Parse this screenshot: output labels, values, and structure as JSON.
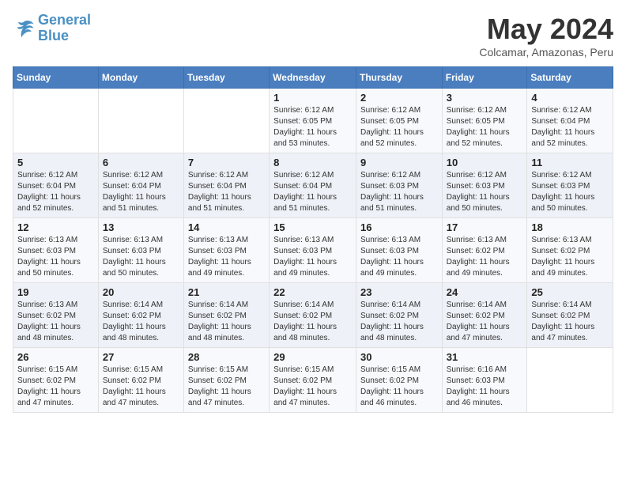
{
  "logo": {
    "line1": "General",
    "line2": "Blue"
  },
  "title": "May 2024",
  "subtitle": "Colcamar, Amazonas, Peru",
  "weekdays": [
    "Sunday",
    "Monday",
    "Tuesday",
    "Wednesday",
    "Thursday",
    "Friday",
    "Saturday"
  ],
  "weeks": [
    [
      {
        "day": "",
        "info": ""
      },
      {
        "day": "",
        "info": ""
      },
      {
        "day": "",
        "info": ""
      },
      {
        "day": "1",
        "info": "Sunrise: 6:12 AM\nSunset: 6:05 PM\nDaylight: 11 hours and 53 minutes."
      },
      {
        "day": "2",
        "info": "Sunrise: 6:12 AM\nSunset: 6:05 PM\nDaylight: 11 hours and 52 minutes."
      },
      {
        "day": "3",
        "info": "Sunrise: 6:12 AM\nSunset: 6:05 PM\nDaylight: 11 hours and 52 minutes."
      },
      {
        "day": "4",
        "info": "Sunrise: 6:12 AM\nSunset: 6:04 PM\nDaylight: 11 hours and 52 minutes."
      }
    ],
    [
      {
        "day": "5",
        "info": "Sunrise: 6:12 AM\nSunset: 6:04 PM\nDaylight: 11 hours and 52 minutes."
      },
      {
        "day": "6",
        "info": "Sunrise: 6:12 AM\nSunset: 6:04 PM\nDaylight: 11 hours and 51 minutes."
      },
      {
        "day": "7",
        "info": "Sunrise: 6:12 AM\nSunset: 6:04 PM\nDaylight: 11 hours and 51 minutes."
      },
      {
        "day": "8",
        "info": "Sunrise: 6:12 AM\nSunset: 6:04 PM\nDaylight: 11 hours and 51 minutes."
      },
      {
        "day": "9",
        "info": "Sunrise: 6:12 AM\nSunset: 6:03 PM\nDaylight: 11 hours and 51 minutes."
      },
      {
        "day": "10",
        "info": "Sunrise: 6:12 AM\nSunset: 6:03 PM\nDaylight: 11 hours and 50 minutes."
      },
      {
        "day": "11",
        "info": "Sunrise: 6:12 AM\nSunset: 6:03 PM\nDaylight: 11 hours and 50 minutes."
      }
    ],
    [
      {
        "day": "12",
        "info": "Sunrise: 6:13 AM\nSunset: 6:03 PM\nDaylight: 11 hours and 50 minutes."
      },
      {
        "day": "13",
        "info": "Sunrise: 6:13 AM\nSunset: 6:03 PM\nDaylight: 11 hours and 50 minutes."
      },
      {
        "day": "14",
        "info": "Sunrise: 6:13 AM\nSunset: 6:03 PM\nDaylight: 11 hours and 49 minutes."
      },
      {
        "day": "15",
        "info": "Sunrise: 6:13 AM\nSunset: 6:03 PM\nDaylight: 11 hours and 49 minutes."
      },
      {
        "day": "16",
        "info": "Sunrise: 6:13 AM\nSunset: 6:03 PM\nDaylight: 11 hours and 49 minutes."
      },
      {
        "day": "17",
        "info": "Sunrise: 6:13 AM\nSunset: 6:02 PM\nDaylight: 11 hours and 49 minutes."
      },
      {
        "day": "18",
        "info": "Sunrise: 6:13 AM\nSunset: 6:02 PM\nDaylight: 11 hours and 49 minutes."
      }
    ],
    [
      {
        "day": "19",
        "info": "Sunrise: 6:13 AM\nSunset: 6:02 PM\nDaylight: 11 hours and 48 minutes."
      },
      {
        "day": "20",
        "info": "Sunrise: 6:14 AM\nSunset: 6:02 PM\nDaylight: 11 hours and 48 minutes."
      },
      {
        "day": "21",
        "info": "Sunrise: 6:14 AM\nSunset: 6:02 PM\nDaylight: 11 hours and 48 minutes."
      },
      {
        "day": "22",
        "info": "Sunrise: 6:14 AM\nSunset: 6:02 PM\nDaylight: 11 hours and 48 minutes."
      },
      {
        "day": "23",
        "info": "Sunrise: 6:14 AM\nSunset: 6:02 PM\nDaylight: 11 hours and 48 minutes."
      },
      {
        "day": "24",
        "info": "Sunrise: 6:14 AM\nSunset: 6:02 PM\nDaylight: 11 hours and 47 minutes."
      },
      {
        "day": "25",
        "info": "Sunrise: 6:14 AM\nSunset: 6:02 PM\nDaylight: 11 hours and 47 minutes."
      }
    ],
    [
      {
        "day": "26",
        "info": "Sunrise: 6:15 AM\nSunset: 6:02 PM\nDaylight: 11 hours and 47 minutes."
      },
      {
        "day": "27",
        "info": "Sunrise: 6:15 AM\nSunset: 6:02 PM\nDaylight: 11 hours and 47 minutes."
      },
      {
        "day": "28",
        "info": "Sunrise: 6:15 AM\nSunset: 6:02 PM\nDaylight: 11 hours and 47 minutes."
      },
      {
        "day": "29",
        "info": "Sunrise: 6:15 AM\nSunset: 6:02 PM\nDaylight: 11 hours and 47 minutes."
      },
      {
        "day": "30",
        "info": "Sunrise: 6:15 AM\nSunset: 6:02 PM\nDaylight: 11 hours and 46 minutes."
      },
      {
        "day": "31",
        "info": "Sunrise: 6:16 AM\nSunset: 6:03 PM\nDaylight: 11 hours and 46 minutes."
      },
      {
        "day": "",
        "info": ""
      }
    ]
  ]
}
